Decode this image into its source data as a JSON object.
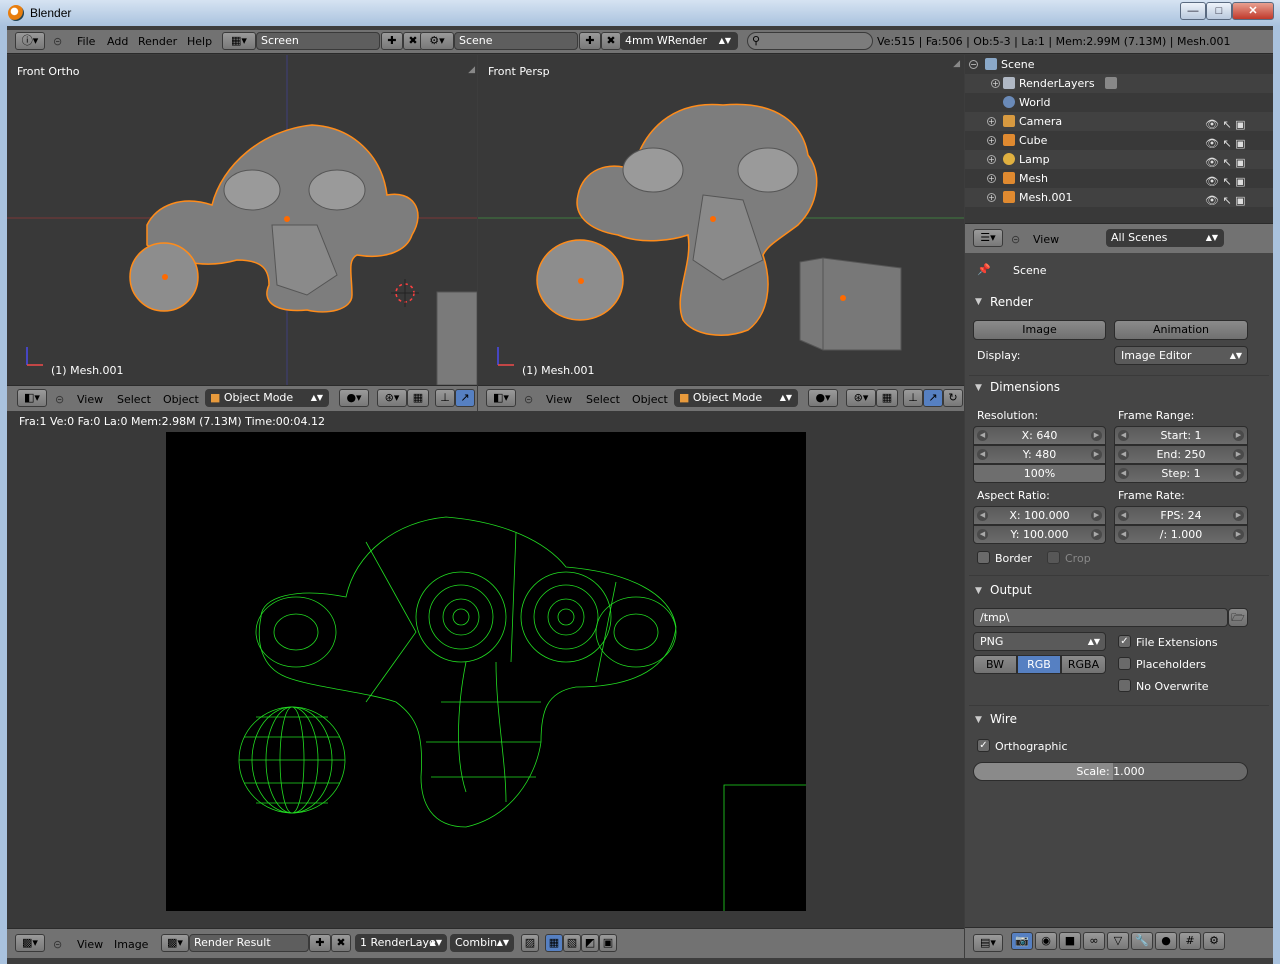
{
  "window": {
    "title": "Blender",
    "min": "—",
    "max": "□",
    "close": "✕"
  },
  "info_header": {
    "menus": [
      "File",
      "Add",
      "Render",
      "Help"
    ],
    "screen": "Screen",
    "scene": "Scene",
    "render_engine": "4mm WRender",
    "search_placeholder": "",
    "stats": "Ve:515 | Fa:506 | Ob:5-3 | La:1 | Mem:2.99M (7.13M) | Mesh.001"
  },
  "viewport_left": {
    "label": "Front Ortho",
    "object": "(1) Mesh.001",
    "menus": [
      "View",
      "Select",
      "Object"
    ],
    "mode": "Object Mode"
  },
  "viewport_right": {
    "label": "Front Persp",
    "object": "(1) Mesh.001",
    "menus": [
      "View",
      "Select",
      "Object"
    ],
    "mode": "Object Mode"
  },
  "render_view": {
    "status": "Fra:1  Ve:0 Fa:0 La:0 Mem:2.98M (7.13M) Time:00:04.12",
    "menus": [
      "View",
      "Image"
    ],
    "image": "Render Result",
    "layer": "1 RenderLaye",
    "pass": "Combin"
  },
  "outliner": {
    "items": [
      {
        "label": "Scene",
        "indent": 0,
        "icon": "scene-icon"
      },
      {
        "label": "RenderLayers",
        "indent": 1,
        "icon": "renderlayers-icon"
      },
      {
        "label": "World",
        "indent": 1,
        "icon": "world-icon"
      },
      {
        "label": "Camera",
        "indent": 1,
        "icon": "camera-icon"
      },
      {
        "label": "Cube",
        "indent": 1,
        "icon": "mesh-icon"
      },
      {
        "label": "Lamp",
        "indent": 1,
        "icon": "lamp-icon"
      },
      {
        "label": "Mesh",
        "indent": 1,
        "icon": "mesh-icon"
      },
      {
        "label": "Mesh.001",
        "indent": 1,
        "icon": "mesh-icon"
      }
    ],
    "footer_view": "View",
    "display_mode": "All Scenes"
  },
  "properties": {
    "context": "Scene",
    "render": {
      "title": "Render",
      "image_btn": "Image",
      "animation_btn": "Animation",
      "display_label": "Display:",
      "display_value": "Image Editor"
    },
    "dimensions": {
      "title": "Dimensions",
      "resolution_label": "Resolution:",
      "res_x": "X: 640",
      "res_y": "Y: 480",
      "res_pct": "100%",
      "frame_range_label": "Frame Range:",
      "start": "Start: 1",
      "end": "End: 250",
      "step": "Step: 1",
      "aspect_label": "Aspect Ratio:",
      "aspect_x": "X: 100.000",
      "aspect_y": "Y: 100.000",
      "frame_rate_label": "Frame Rate:",
      "fps": "FPS: 24",
      "fps_base": "/: 1.000",
      "border": "Border",
      "crop": "Crop"
    },
    "output": {
      "title": "Output",
      "path": "/tmp\\",
      "format": "PNG",
      "color_modes": [
        "BW",
        "RGB",
        "RGBA"
      ],
      "active_color": "RGB",
      "file_extensions": "File Extensions",
      "placeholders": "Placeholders",
      "no_overwrite": "No Overwrite"
    },
    "wire": {
      "title": "Wire",
      "orthographic": "Orthographic",
      "scale": "Scale: 1.000"
    }
  }
}
